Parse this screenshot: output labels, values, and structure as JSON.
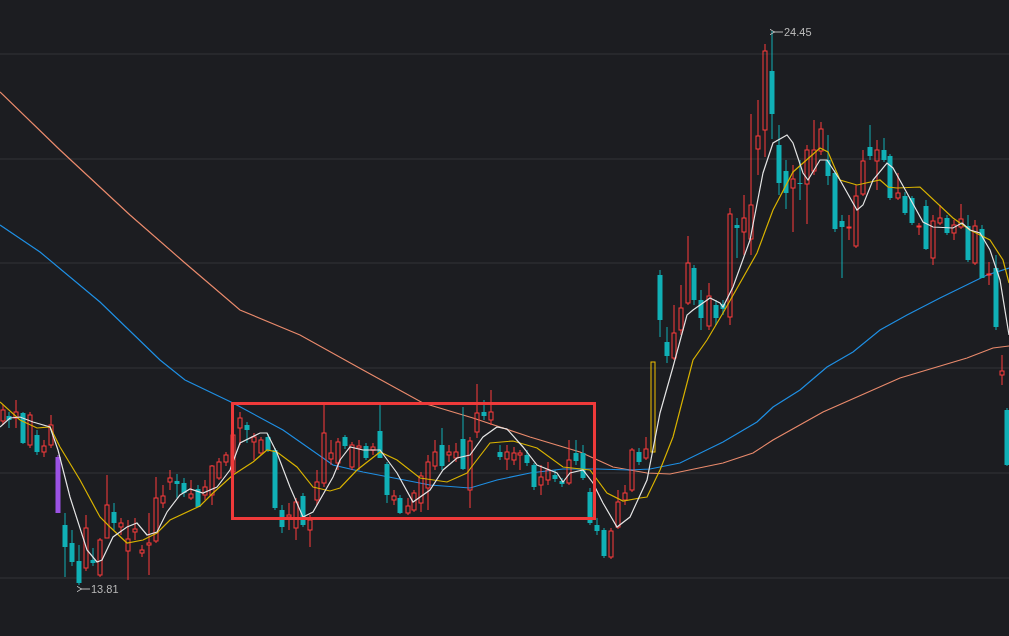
{
  "chart": {
    "high_marker": {
      "label": "24.45"
    },
    "low_marker": {
      "label": "13.81"
    }
  }
}
